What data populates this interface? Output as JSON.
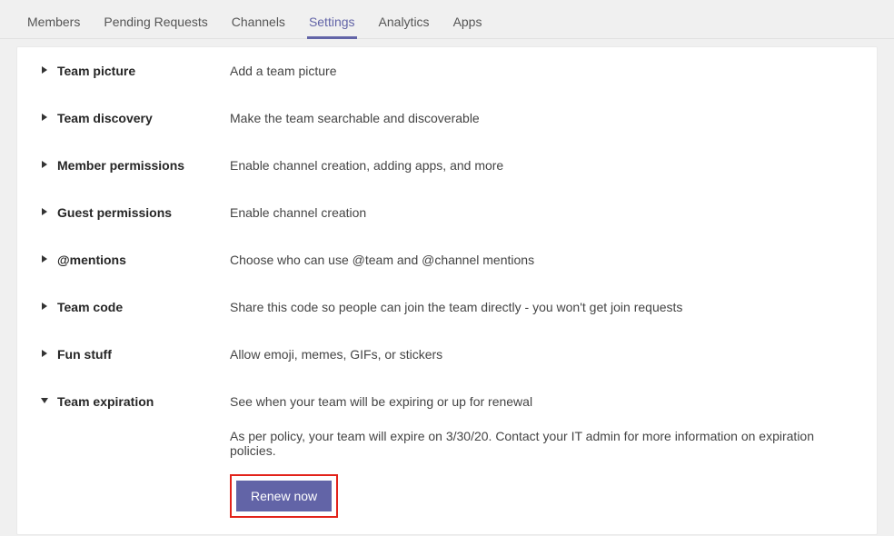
{
  "tabs": {
    "items": [
      {
        "label": "Members"
      },
      {
        "label": "Pending Requests"
      },
      {
        "label": "Channels"
      },
      {
        "label": "Settings"
      },
      {
        "label": "Analytics"
      },
      {
        "label": "Apps"
      }
    ],
    "activeIndex": 3
  },
  "sections": {
    "teamPicture": {
      "title": "Team picture",
      "desc": "Add a team picture"
    },
    "teamDiscovery": {
      "title": "Team discovery",
      "desc": "Make the team searchable and discoverable"
    },
    "memberPermissions": {
      "title": "Member permissions",
      "desc": "Enable channel creation, adding apps, and more"
    },
    "guestPermissions": {
      "title": "Guest permissions",
      "desc": "Enable channel creation"
    },
    "mentions": {
      "title": "@mentions",
      "desc": "Choose who can use @team and @channel mentions"
    },
    "teamCode": {
      "title": "Team code",
      "desc": "Share this code so people can join the team directly - you won't get join requests"
    },
    "funStuff": {
      "title": "Fun stuff",
      "desc": "Allow emoji, memes, GIFs, or stickers"
    },
    "teamExpiration": {
      "title": "Team expiration",
      "desc": "See when your team will be expiring or up for renewal",
      "policy": "As per policy, your team will expire on 3/30/20. Contact your IT admin for more information on expiration policies.",
      "renewLabel": "Renew now"
    }
  }
}
